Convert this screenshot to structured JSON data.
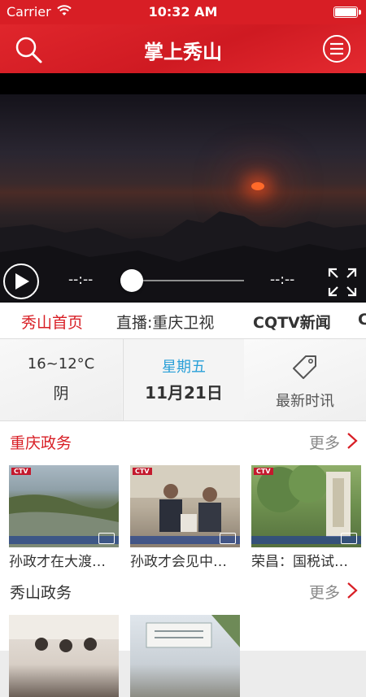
{
  "status_bar": {
    "carrier": "Carrier",
    "time": "10:32 AM",
    "battery_level": 1.0
  },
  "header": {
    "title": "掌上秀山"
  },
  "player": {
    "elapsed": "--:--",
    "duration": "--:--",
    "progress": 0.0
  },
  "tabs": [
    {
      "label": "秀山首页",
      "active": true
    },
    {
      "label": "直播:重庆卫视",
      "active": false
    },
    {
      "label": "CQTV新闻",
      "active": false
    },
    {
      "label": "C",
      "active": false
    }
  ],
  "info": {
    "temperature": "16~12°C",
    "weather": "阴",
    "weekday": "星期五",
    "date": "11月21日",
    "news_label": "最新时讯"
  },
  "sections": [
    {
      "title": "重庆政务",
      "more": "更多",
      "items": [
        {
          "caption": "孙政才在大渡…"
        },
        {
          "caption": "孙政才会见中…"
        },
        {
          "caption": "荣昌：国税试…"
        }
      ]
    },
    {
      "title": "秀山政务",
      "more": "更多",
      "items": [
        {
          "caption": ""
        },
        {
          "caption": ""
        }
      ]
    }
  ],
  "colors": {
    "brand_red": "#d81e25",
    "weekday_blue": "#2aa0d8",
    "section_title_red": "#d81e25"
  }
}
